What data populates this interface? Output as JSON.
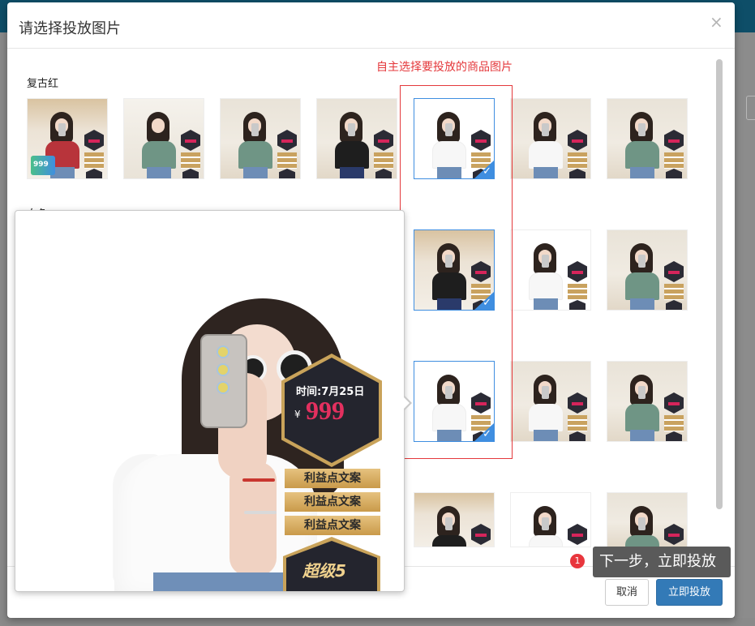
{
  "modal": {
    "title": "请选择投放图片",
    "close": "×"
  },
  "groups": [
    {
      "label": "复古红"
    },
    {
      "label": "白色"
    }
  ],
  "annotation": {
    "text": "自主选择要投放的商品图片"
  },
  "preview": {
    "time_label": "时间:7月25日",
    "currency": "¥",
    "price": "999",
    "benefits": [
      "利益点文案",
      "利益点文案",
      "利益点文案"
    ],
    "badge": "超级5"
  },
  "footer": {
    "cancel_label": "取消",
    "submit_label": "立即投放"
  },
  "tooltip": {
    "step_number": "1",
    "text": "下一步，立即投放"
  },
  "thumbnails": {
    "row1": [
      "selected:false",
      "selected:false",
      "selected:false",
      "selected:false",
      "selected:true",
      "selected:false",
      "selected:false"
    ],
    "row2_visible": [
      "selected:true",
      "selected:false",
      "selected:false"
    ],
    "row3_visible": [
      "selected:true",
      "selected:false",
      "selected:false"
    ],
    "row4_visible": [
      "selected:false",
      "selected:false",
      "selected:false"
    ]
  },
  "colors": {
    "accent": "#337ab7",
    "check": "#3f8ee0",
    "annotation": "#e4393c",
    "step_badge": "#e8363d"
  }
}
